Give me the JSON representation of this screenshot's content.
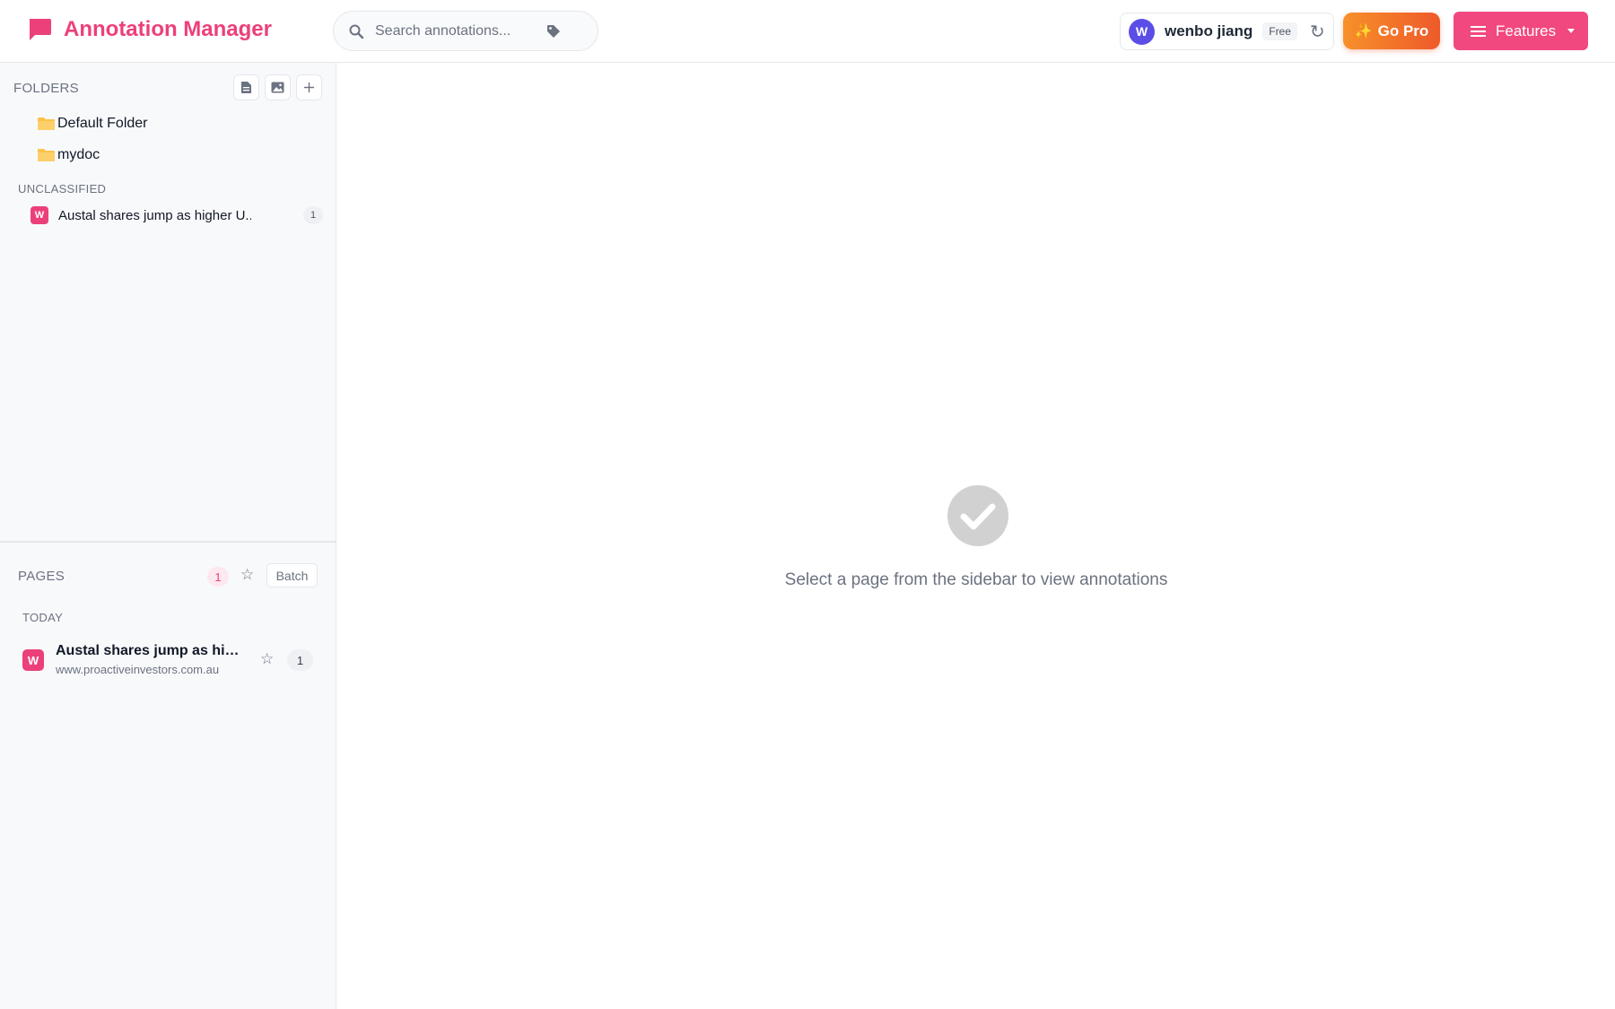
{
  "header": {
    "app_title": "Annotation Manager",
    "search_placeholder": "Search annotations...",
    "user": {
      "initial": "W",
      "name": "wenbo jiang",
      "plan": "Free",
      "refresh_glyph": "↻"
    },
    "go_pro": {
      "spark": "✨",
      "label": "Go Pro"
    },
    "features": {
      "label": "Features"
    }
  },
  "sidebar": {
    "folders_heading": "FOLDERS",
    "folders": [
      {
        "name": "Default Folder"
      },
      {
        "name": "mydoc"
      }
    ],
    "unclassified_heading": "UNCLASSIFIED",
    "unclassified": [
      {
        "badge": "W",
        "title": "Austal shares jump as higher U...",
        "count": "1"
      }
    ],
    "pages_heading": "PAGES",
    "pages_count": "1",
    "star_glyph": "☆",
    "batch_label": "Batch",
    "today_heading": "TODAY",
    "pages": [
      {
        "badge": "W",
        "title": "Austal shares jump as higher US Navy...",
        "url": "www.proactiveinvestors.com.au",
        "count": "1"
      }
    ]
  },
  "main": {
    "empty_message": "Select a page from the sidebar to view annotations"
  },
  "colors": {
    "brand": "#ec407a",
    "features_button": "#f0487f",
    "go_pro_gradient_start": "#f7902a",
    "go_pro_gradient_end": "#ee5a2a",
    "avatar": "#5b4ee6",
    "folder": "#fbc34a"
  },
  "icons": {
    "logo": "speech-bubble-icon",
    "search": "search-icon",
    "tag": "tag-icon",
    "refresh": "refresh-icon",
    "features_menu": "hamburger-menu-icon",
    "new_document": "document-icon",
    "new_image": "image-icon",
    "add_folder": "plus-icon",
    "folder": "folder-icon",
    "star": "star-outline-icon",
    "empty_state": "check-circle-icon"
  }
}
